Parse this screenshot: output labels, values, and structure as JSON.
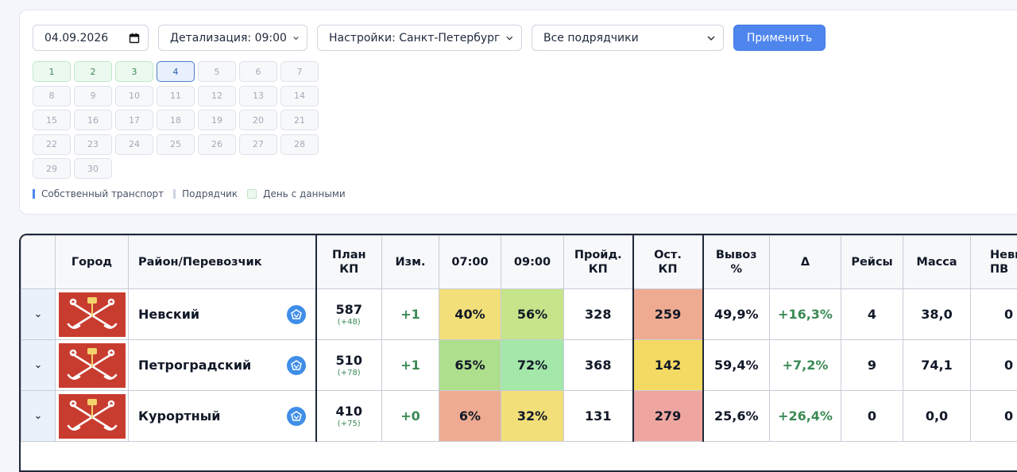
{
  "filters": {
    "date": "04.09.2026",
    "detail": "Детализация: 09:00",
    "settings": "Настройки: Санкт-Петербург",
    "contractors": "Все подрядчики",
    "apply": "Применить"
  },
  "calendar": {
    "days": [
      "1",
      "2",
      "3",
      "4",
      "5",
      "6",
      "7",
      "8",
      "9",
      "10",
      "11",
      "12",
      "13",
      "14",
      "15",
      "16",
      "17",
      "18",
      "19",
      "20",
      "21",
      "22",
      "23",
      "24",
      "25",
      "26",
      "27",
      "28",
      "29",
      "30"
    ],
    "data_days": [
      "1",
      "2",
      "3"
    ],
    "selected_day": "4"
  },
  "legend": {
    "own": "Собственный транспорт",
    "contractor": "Подрядчик",
    "data_day": "День с данными"
  },
  "table": {
    "headers": {
      "city": "Город",
      "district": "Район/Перевозчик",
      "plan": "План КП",
      "change": "Изм.",
      "t0700": "07:00",
      "t0900": "09:00",
      "passed": "Пройд. КП",
      "remaining": "Ост. КП",
      "export": "Вывоз %",
      "delta": "Δ",
      "trips": "Рейсы",
      "mass": "Масса",
      "unexported": "Невы ПВ"
    },
    "rows": [
      {
        "expand": "⌄",
        "district": "Невский",
        "plan": "587",
        "plan_delta": "(+48)",
        "change": "+1",
        "t0700": "40%",
        "t0700_color": "#f2df79",
        "t0900": "56%",
        "t0900_color": "#c6e48a",
        "passed": "328",
        "remaining": "259",
        "remaining_color": "#efab92",
        "export": "49,9%",
        "delta": "+16,3%",
        "trips": "4",
        "mass": "38,0",
        "unexported": "0"
      },
      {
        "expand": "⌄",
        "district": "Петроградский",
        "plan": "510",
        "plan_delta": "(+78)",
        "change": "+1",
        "t0700": "65%",
        "t0700_color": "#addf8d",
        "t0900": "72%",
        "t0900_color": "#a3e8a8",
        "passed": "368",
        "remaining": "142",
        "remaining_color": "#f4da62",
        "export": "59,4%",
        "delta": "+7,2%",
        "trips": "9",
        "mass": "74,1",
        "unexported": "0"
      },
      {
        "expand": "⌄",
        "district": "Курортный",
        "plan": "410",
        "plan_delta": "(+75)",
        "change": "+0",
        "t0700": "6%",
        "t0700_color": "#efab92",
        "t0900": "32%",
        "t0900_color": "#f2df79",
        "passed": "131",
        "remaining": "279",
        "remaining_color": "#efa6a0",
        "export": "25,6%",
        "delta": "+26,4%",
        "trips": "0",
        "mass": "0,0",
        "unexported": "0"
      }
    ]
  }
}
